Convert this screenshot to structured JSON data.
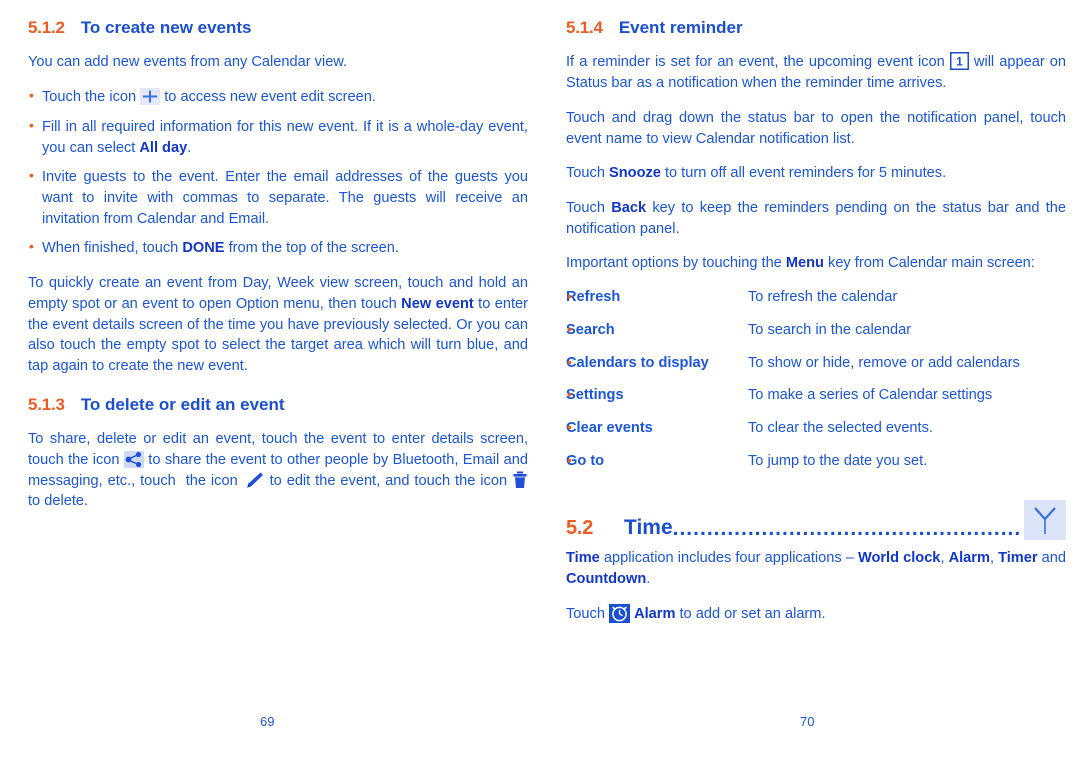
{
  "colors": {
    "heading_number": "#ec5b22",
    "heading_text": "#1a4fd0",
    "body_text": "#1a56d6",
    "bullet": "#ec5b22",
    "icon_blue": "#1a4fd0",
    "icon_bg_light": "#dbe4f9"
  },
  "left_page": {
    "page_number": "69",
    "section_512": {
      "number": "5.1.2",
      "title": "To create new events",
      "intro": "You can add new events from any Calendar view.",
      "bullets": [
        {
          "parts": [
            {
              "t": "Touch the icon ",
              "b": false
            },
            {
              "t": "ICON:plus",
              "b": false
            },
            {
              "t": " to access new event edit screen.",
              "b": false
            }
          ],
          "plain": "Touch the icon  to access new event edit screen."
        },
        {
          "plain": "Fill in all required information for this new event. If it is a whole-day event, you can select All day.",
          "bold_words": [
            "All day"
          ]
        },
        {
          "plain": "Invite guests to the event. Enter the email addresses of the guests you want to invite with commas to separate. The guests will receive an invitation from Calendar and Email."
        },
        {
          "plain": "When finished, touch DONE from the top of the screen.",
          "bold_words": [
            "DONE"
          ]
        }
      ],
      "paragraph": "To quickly create an event from Day, Week view screen, touch and hold an empty spot or an event to open Option menu, then touch New event to enter the event details screen of the time you have previously selected. Or you can also touch the empty spot to select the target area which will turn blue, and tap again to create the new event.",
      "paragraph_bold": [
        "New event"
      ]
    },
    "section_513": {
      "number": "5.1.3",
      "title": "To delete or edit an event",
      "paragraph": "To share, delete or edit an event, touch the event to enter details screen, touch the icon  to share the event to other people by Bluetooth, Email and messaging, etc., touch  the icon  to edit the event, and touch the icon  to delete."
    }
  },
  "right_page": {
    "page_number": "70",
    "section_514": {
      "number": "5.1.4",
      "title": "Event reminder",
      "para1_before": "If a reminder is set for an event, the upcoming event icon ",
      "para1_after": " will appear on Status bar as a notification when the reminder time arrives.",
      "para2": "Touch and drag down the status bar to open the notification panel, touch event name to view Calendar notification list.",
      "para3_pre": "Touch ",
      "para3_bold": "Snooze",
      "para3_post": " to turn off all event reminders for 5 minutes.",
      "para4_pre": "Touch ",
      "para4_bold": "Back",
      "para4_post": " key to keep the reminders pending on the status bar and the notification panel.",
      "para5_pre": "Important options by touching the ",
      "para5_bold": "Menu",
      "para5_post": " key from Calendar main screen:",
      "options_table": [
        {
          "name": "Refresh",
          "desc": "To refresh the calendar"
        },
        {
          "name": "Search",
          "desc": "To search in the calendar"
        },
        {
          "name": "Calendars to display",
          "desc": "To show or hide, remove or add calendars"
        },
        {
          "name": "Settings",
          "desc": "To make a series of Calendar settings"
        },
        {
          "name": "Clear events",
          "desc": "To clear the selected events."
        },
        {
          "name": "Go to",
          "desc": "To jump to the date you set."
        }
      ]
    },
    "section_52": {
      "number": "5.2",
      "title": "Time",
      "leader": "..........................................................................",
      "para1_pre": "Time",
      "para1_mid": " application includes four applications – ",
      "para1_b1": "World clock",
      "para1_sep1": ", ",
      "para1_b2": "Alarm",
      "para1_sep2": ", ",
      "para1_b3": "Timer",
      "para1_sep3": " and ",
      "para1_b4": "Countdown",
      "para1_end": ".",
      "para2_pre": "Touch ",
      "para2_bold": "Alarm",
      "para2_post": " to add or set an alarm."
    }
  },
  "icons": {
    "plus": "plus-icon",
    "share": "share-icon",
    "pencil": "pencil-edit-icon",
    "trash": "trash-delete-icon",
    "calendar_notification": "calendar-notification-icon",
    "time_app": "time-app-icon",
    "alarm": "alarm-clock-icon"
  }
}
